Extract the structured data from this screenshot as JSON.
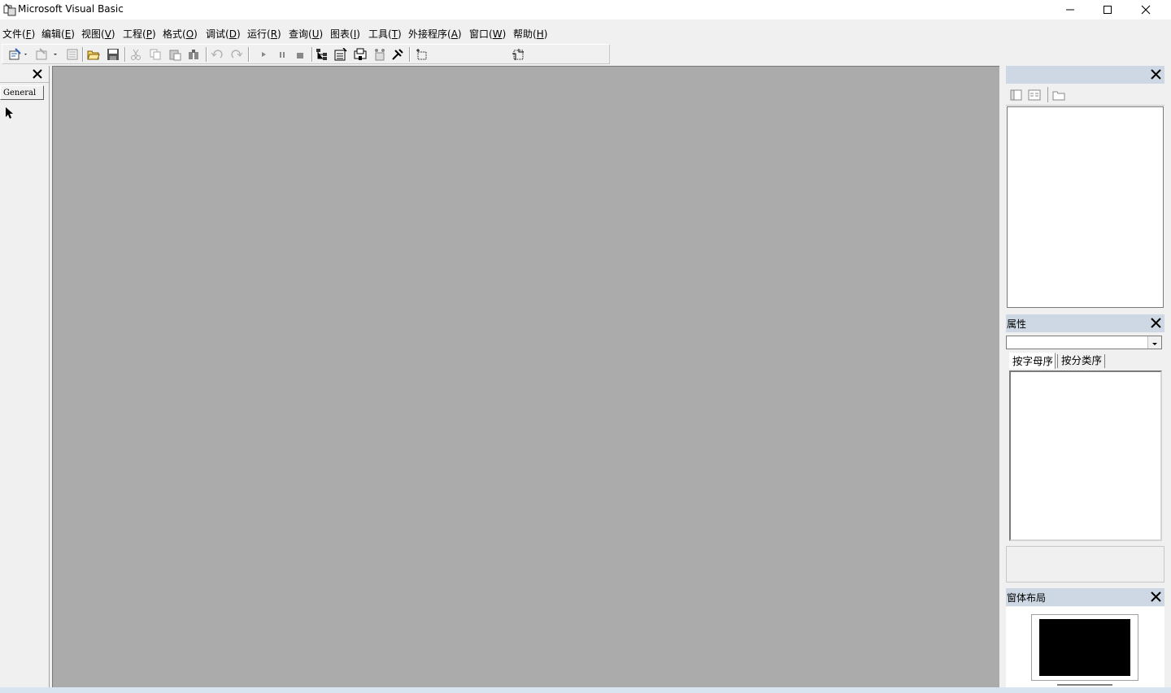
{
  "window": {
    "title": "Microsoft Visual Basic",
    "controls": [
      "minimize-icon",
      "maximize-icon",
      "close-icon"
    ]
  },
  "menu": [
    {
      "label": "文件",
      "key": "F"
    },
    {
      "label": "编辑",
      "key": "E"
    },
    {
      "label": "视图",
      "key": "V"
    },
    {
      "label": "工程",
      "key": "P"
    },
    {
      "label": "格式",
      "key": "O"
    },
    {
      "label": "调试",
      "key": "D"
    },
    {
      "label": "运行",
      "key": "R"
    },
    {
      "label": "查询",
      "key": "U"
    },
    {
      "label": "图表",
      "key": "I"
    },
    {
      "label": "工具",
      "key": "T"
    },
    {
      "label": "外接程序",
      "key": "A"
    },
    {
      "label": "窗口",
      "key": "W"
    },
    {
      "label": "帮助",
      "key": "H"
    }
  ],
  "toolbar": {
    "buttons": [
      "add-project-icon",
      "add-form-icon",
      "menu-editor-icon",
      "open-project-icon",
      "save-project-icon",
      "cut-icon",
      "copy-icon",
      "paste-icon",
      "find-icon",
      "undo-icon",
      "redo-icon",
      "start-icon",
      "break-icon",
      "end-icon",
      "project-explorer-icon",
      "properties-window-icon",
      "form-layout-icon",
      "object-browser-icon",
      "toolbox-icon",
      "position-icon",
      "size-icon"
    ]
  },
  "toolbox": {
    "tab_label": "General",
    "tools": [
      "pointer-icon"
    ]
  },
  "project_pane": {
    "title": "",
    "buttons": [
      "view-code-icon",
      "view-object-icon",
      "toggle-folders-icon"
    ]
  },
  "properties_pane": {
    "title": "属性",
    "object_selector": "",
    "tabs": [
      "按字母序",
      "按分类序"
    ],
    "active_tab": 0
  },
  "layout_pane": {
    "title": "窗体布局"
  },
  "colors": {
    "workspace": "#ababab",
    "pane_header": "#cdd8e4",
    "panel": "#f0f0f0"
  }
}
